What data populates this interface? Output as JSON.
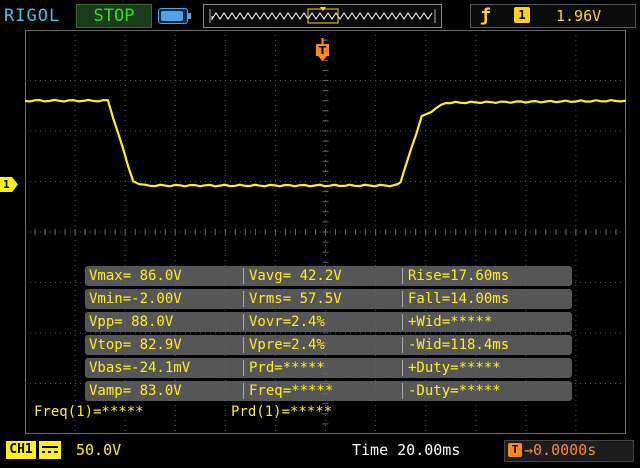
{
  "header": {
    "brand": "RIGOL",
    "run_status": "STOP",
    "trigger": {
      "edge_icon": "rising-edge-icon",
      "source": "1",
      "level": "1.96V"
    }
  },
  "colors": {
    "ch1": "#ffef1a",
    "brand": "#39c6e8",
    "run": "#22e81a",
    "trigger": "#ffd21a",
    "trigger_marker": "#ff8a1a"
  },
  "markers": {
    "time_marker": "T",
    "channel_marker": "1"
  },
  "waveform": {
    "description_points_fraction": [
      [
        0,
        0.175
      ],
      [
        0.138,
        0.175
      ],
      [
        0.18,
        0.375
      ],
      [
        0.2,
        0.385
      ],
      [
        0.615,
        0.385
      ],
      [
        0.625,
        0.375
      ],
      [
        0.66,
        0.215
      ],
      [
        0.7,
        0.18
      ],
      [
        1,
        0.175
      ]
    ]
  },
  "measurements": {
    "col1": [
      "Vmax= 86.0V",
      "Vmin=-2.00V",
      "Vpp= 88.0V",
      "Vtop= 82.9V",
      "Vbas=-24.1mV",
      "Vamp= 83.0V"
    ],
    "col2": [
      "Vavg= 42.2V",
      "Vrms= 57.5V",
      "Vovr=2.4%",
      "Vpre=2.4%",
      "Prd=*****",
      "Freq=*****"
    ],
    "col3": [
      "Rise=17.60ms",
      "Fall=14.00ms",
      "+Wid=*****",
      "-Wid=118.4ms",
      "+Duty=*****",
      "-Duty=*****"
    ]
  },
  "stats": {
    "freq": "Freq(1)=*****",
    "prd": "Prd(1)=*****"
  },
  "footer": {
    "channel_tag": "CH1",
    "ch1_scale": "50.0V",
    "time_scale": "Time 20.00ms",
    "trigger_offset": "0.0000s",
    "trigger_offset_icon": "T"
  }
}
